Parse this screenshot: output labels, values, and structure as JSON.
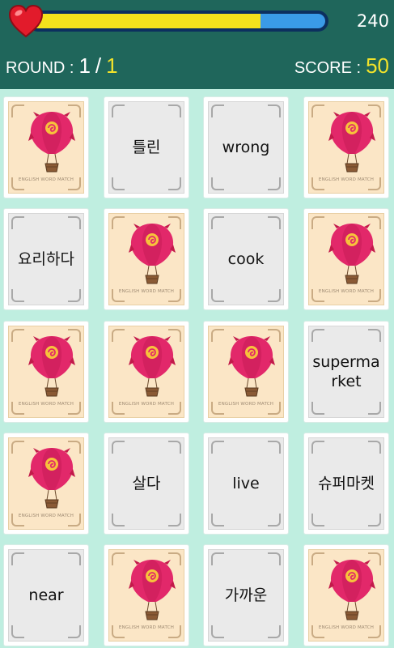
{
  "hud": {
    "timer_value": "240",
    "timer_fraction": 0.78,
    "round_label": "ROUND :",
    "round_current": "1",
    "round_separator": "/",
    "round_total": "1",
    "score_label": "SCORE :",
    "score_value": "50"
  },
  "card_back_caption": "ENGLISH WORD MATCH",
  "cards": [
    {
      "face": "back",
      "text": ""
    },
    {
      "face": "word",
      "text": "틀린"
    },
    {
      "face": "word",
      "text": "wrong"
    },
    {
      "face": "back",
      "text": ""
    },
    {
      "face": "word",
      "text": "요리하다"
    },
    {
      "face": "back",
      "text": ""
    },
    {
      "face": "word",
      "text": "cook"
    },
    {
      "face": "back",
      "text": ""
    },
    {
      "face": "back",
      "text": ""
    },
    {
      "face": "back",
      "text": ""
    },
    {
      "face": "back",
      "text": ""
    },
    {
      "face": "word",
      "text": "supermarket"
    },
    {
      "face": "back",
      "text": ""
    },
    {
      "face": "word",
      "text": "살다"
    },
    {
      "face": "word",
      "text": "live"
    },
    {
      "face": "word",
      "text": "슈퍼마켓"
    },
    {
      "face": "word",
      "text": "near"
    },
    {
      "face": "back",
      "text": ""
    },
    {
      "face": "word",
      "text": "가까운"
    },
    {
      "face": "back",
      "text": ""
    }
  ],
  "colors": {
    "header_bg": "#1f665b",
    "board_bg": "#bfeee0",
    "bar_fill": "#f4e21c",
    "bar_empty": "#3a9be8",
    "heart": "#e21b2b"
  }
}
